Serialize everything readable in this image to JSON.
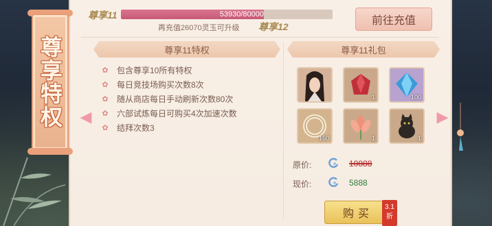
{
  "banner": {
    "title": "尊享特权"
  },
  "status": {
    "current_vip": "尊享11",
    "next_vip": "尊享12",
    "progress_text": "53930/80000",
    "progress": 0.674,
    "upgrade_hint": "再充值26070灵玉可升级",
    "recharge_button": "前往充值"
  },
  "privileges": {
    "title": "尊享11特权",
    "items": [
      "包含尊享10所有特权",
      "每日竞技场购买次数8次",
      "随从商店每日手动刷新次数80次",
      "六部试炼每日可购买4次加速次数",
      "结拜次数3"
    ]
  },
  "gift": {
    "title": "尊享11礼包",
    "slots": [
      {
        "icon": "hero-portrait-icon",
        "count": ""
      },
      {
        "icon": "red-gem-icon",
        "count": "1"
      },
      {
        "icon": "blue-crystal-icon",
        "count": "100"
      },
      {
        "icon": "jade-ring-icon",
        "count": "150"
      },
      {
        "icon": "lotus-flower-icon",
        "count": "1"
      },
      {
        "icon": "black-cat-icon",
        "count": "1"
      }
    ],
    "original_label": "原价:",
    "original_price": "10888",
    "current_label": "现价:",
    "current_price": "5888",
    "buy_button": "购买",
    "discount": "3.1折"
  },
  "colors": {
    "progress": "#c75a76",
    "old_price": "#b42d2d",
    "new_price": "#2e7d3a",
    "buy_button": "#e9c25a"
  }
}
